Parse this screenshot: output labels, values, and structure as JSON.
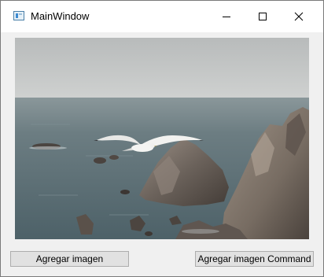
{
  "window": {
    "title": "MainWindow",
    "icon": "app-window-icon",
    "caption_buttons": [
      "minimize-icon",
      "maximize-icon",
      "close-icon"
    ]
  },
  "image": {
    "subject": "seagull-over-rocky-coast-photo",
    "colors": {
      "sky_top": "#b9bcbc",
      "sea": "#566a71",
      "rock": "#6f655d"
    }
  },
  "buttons": {
    "add_image": "Agregar imagen",
    "add_image_command": "Agregar imagen Command"
  }
}
